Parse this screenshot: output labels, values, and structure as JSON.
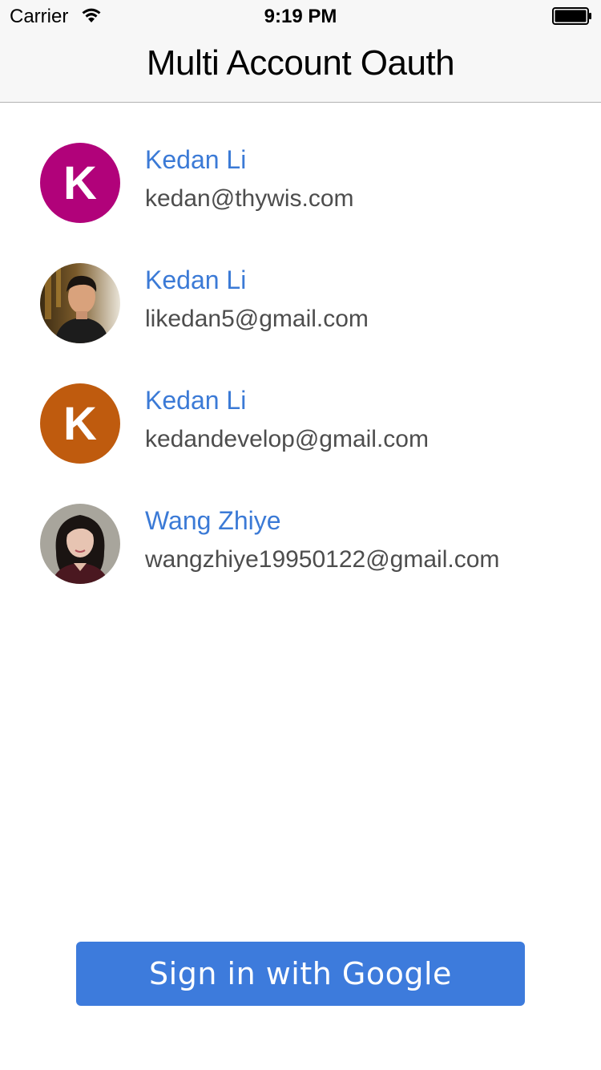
{
  "status_bar": {
    "carrier": "Carrier",
    "time": "9:19 PM",
    "wifi_icon": "wifi-icon",
    "battery_icon": "battery-full-icon"
  },
  "nav": {
    "title": "Multi Account Oauth"
  },
  "accounts": [
    {
      "name": "Kedan Li",
      "email": "kedan@thywis.com",
      "avatar_type": "letter",
      "avatar_letter": "K",
      "avatar_color": "#b1027a"
    },
    {
      "name": "Kedan Li",
      "email": "likedan5@gmail.com",
      "avatar_type": "photo",
      "avatar_desc_icon": "person-photo-avatar"
    },
    {
      "name": "Kedan Li",
      "email": "kedandevelop@gmail.com",
      "avatar_type": "letter",
      "avatar_letter": "K",
      "avatar_color": "#bf5b0e"
    },
    {
      "name": "Wang Zhiye",
      "email": "wangzhiye19950122@gmail.com",
      "avatar_type": "photo",
      "avatar_desc_icon": "person-photo-avatar"
    }
  ],
  "sign_in_button": {
    "label": "Sign in with Google",
    "color": "#3d7bdc"
  },
  "colors": {
    "name_text": "#3b7ad6",
    "email_text": "#4d4d4d",
    "nav_background": "#f7f7f7"
  }
}
